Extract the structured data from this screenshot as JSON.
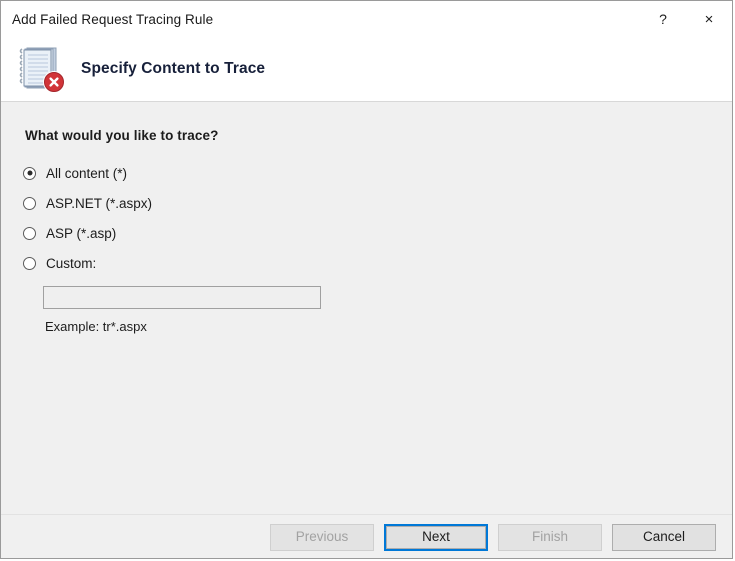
{
  "window": {
    "title": "Add Failed Request Tracing Rule",
    "help_glyph": "?",
    "close_glyph": "×"
  },
  "header": {
    "title": "Specify Content to Trace",
    "icon": "notebook-error-icon"
  },
  "content": {
    "question": "What would you like to trace?",
    "options": [
      {
        "label": "All content (*)",
        "selected": true
      },
      {
        "label": "ASP.NET (*.aspx)",
        "selected": false
      },
      {
        "label": "ASP (*.asp)",
        "selected": false
      },
      {
        "label": "Custom:",
        "selected": false
      }
    ],
    "custom_input": {
      "value": "",
      "placeholder": "",
      "enabled": false
    },
    "example_text": "Example: tr*.aspx"
  },
  "footer": {
    "buttons": [
      {
        "label": "Previous",
        "state": "disabled"
      },
      {
        "label": "Next",
        "state": "focused"
      },
      {
        "label": "Finish",
        "state": "disabled"
      },
      {
        "label": "Cancel",
        "state": "normal"
      }
    ]
  },
  "colors": {
    "accent": "#0078d7",
    "error_badge": "#d13438",
    "window_bg": "#f0f0f0",
    "header_bg": "#ffffff"
  }
}
